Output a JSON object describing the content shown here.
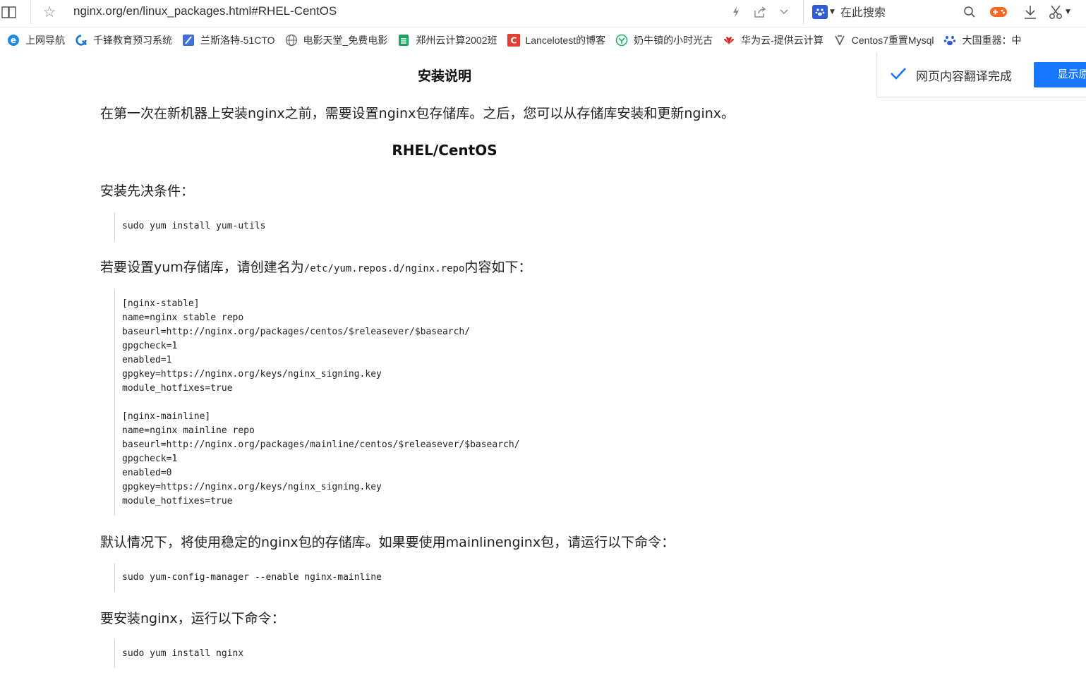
{
  "browser": {
    "url": "nginx.org/en/linux_packages.html#RHEL-CentOS",
    "search_placeholder": "在此搜索",
    "bookmarks": [
      {
        "label": "上网导航",
        "icon": "ie-icon"
      },
      {
        "label": "千锋教育预习系统",
        "icon": "qianfeng-icon"
      },
      {
        "label": "兰斯洛特-51CTO",
        "icon": "blog-pen-icon"
      },
      {
        "label": "电影天堂_免费电影",
        "icon": "globe-icon"
      },
      {
        "label": "郑州云计算2002班",
        "icon": "sheet-icon"
      },
      {
        "label": "Lancelotest的博客",
        "icon": "csdn-icon"
      },
      {
        "label": "奶牛镇的小时光古",
        "icon": "clover-icon"
      },
      {
        "label": "华为云-提供云计算",
        "icon": "huawei-icon"
      },
      {
        "label": "Centos7重置Mysql",
        "icon": "bookmark-link-icon"
      },
      {
        "label": "大国重器：中",
        "icon": "baidu-paw-icon"
      }
    ]
  },
  "translate_toast": {
    "message": "网页内容翻译完成",
    "button": "显示原"
  },
  "article": {
    "title": "安装说明",
    "intro": "在第一次在新机器上安装nginx之前，需要设置nginx包存储库。之后，您可以从存储库安装和更新nginx。",
    "section": "RHEL/CentOS",
    "prereq_label": "安装先决条件：",
    "prereq_cmd": "sudo yum install yum-utils",
    "repo_intro_before": "若要设置yum存储库，请创建名为",
    "repo_path": "/etc/yum.repos.d/nginx.repo",
    "repo_intro_after": "内容如下：",
    "repo_content": "[nginx-stable]\nname=nginx stable repo\nbaseurl=http://nginx.org/packages/centos/$releasever/$basearch/\ngpgcheck=1\nenabled=1\ngpgkey=https://nginx.org/keys/nginx_signing.key\nmodule_hotfixes=true\n\n[nginx-mainline]\nname=nginx mainline repo\nbaseurl=http://nginx.org/packages/mainline/centos/$releasever/$basearch/\ngpgcheck=1\nenabled=0\ngpgkey=https://nginx.org/keys/nginx_signing.key\nmodule_hotfixes=true",
    "mainline_note": "默认情况下，将使用稳定的nginx包的存储库。如果要使用mainlinenginx包，请运行以下命令：",
    "mainline_cmd": "sudo yum-config-manager --enable nginx-mainline",
    "install_label": "要安装nginx，运行以下命令：",
    "install_cmd": "sudo yum install nginx"
  }
}
